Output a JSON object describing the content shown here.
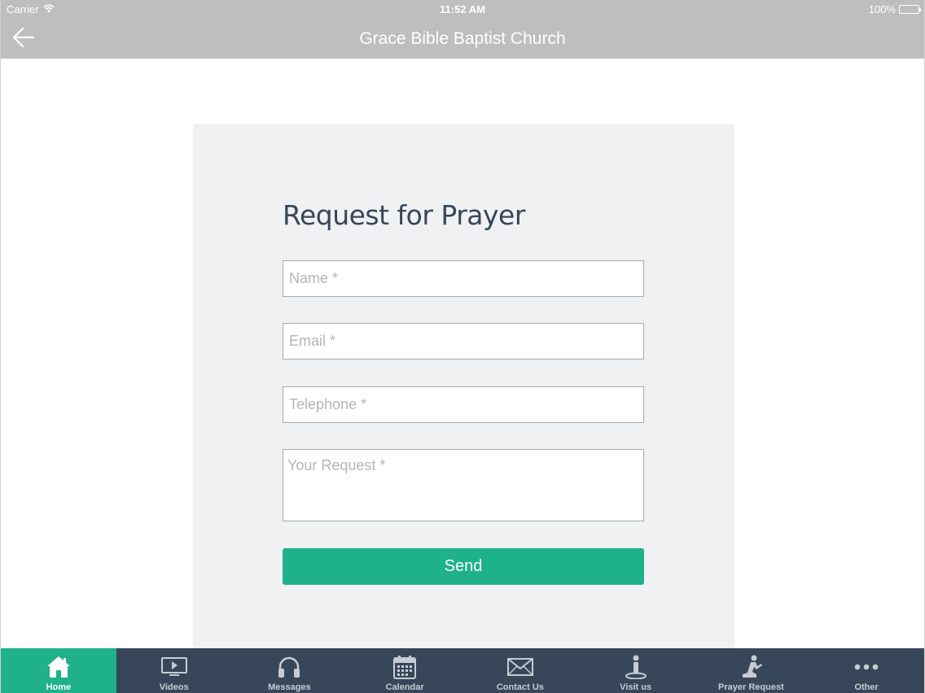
{
  "status_bar": {
    "carrier": "Carrier",
    "time": "11:52 AM",
    "battery": "100%"
  },
  "nav": {
    "title": "Grace Bible Baptist Church",
    "back_icon": "arrow-left-icon"
  },
  "form": {
    "title": "Request for Prayer",
    "fields": {
      "name": {
        "value": "",
        "placeholder": "Name *"
      },
      "email": {
        "value": "",
        "placeholder": "Email *"
      },
      "telephone": {
        "value": "",
        "placeholder": "Telephone *"
      },
      "request": {
        "value": "",
        "placeholder": "Your Request *"
      }
    },
    "send_label": "Send"
  },
  "tabs": [
    {
      "label": "Home",
      "icon": "home-icon",
      "active": true
    },
    {
      "label": "Videos",
      "icon": "video-icon",
      "active": false
    },
    {
      "label": "Messages",
      "icon": "headphones-icon",
      "active": false
    },
    {
      "label": "Calendar",
      "icon": "calendar-icon",
      "active": false
    },
    {
      "label": "Contact Us",
      "icon": "envelope-icon",
      "active": false
    },
    {
      "label": "Visit us",
      "icon": "info-person-icon",
      "active": false
    },
    {
      "label": "Prayer Request",
      "icon": "praying-person-icon",
      "active": false
    },
    {
      "label": "Other",
      "icon": "more-icon",
      "active": false
    }
  ],
  "colors": {
    "header": "#bdbec0",
    "panel": "#f0f1f2",
    "accent": "#1fb18a",
    "tab_bar": "#374759",
    "title_text": "#37475a"
  }
}
